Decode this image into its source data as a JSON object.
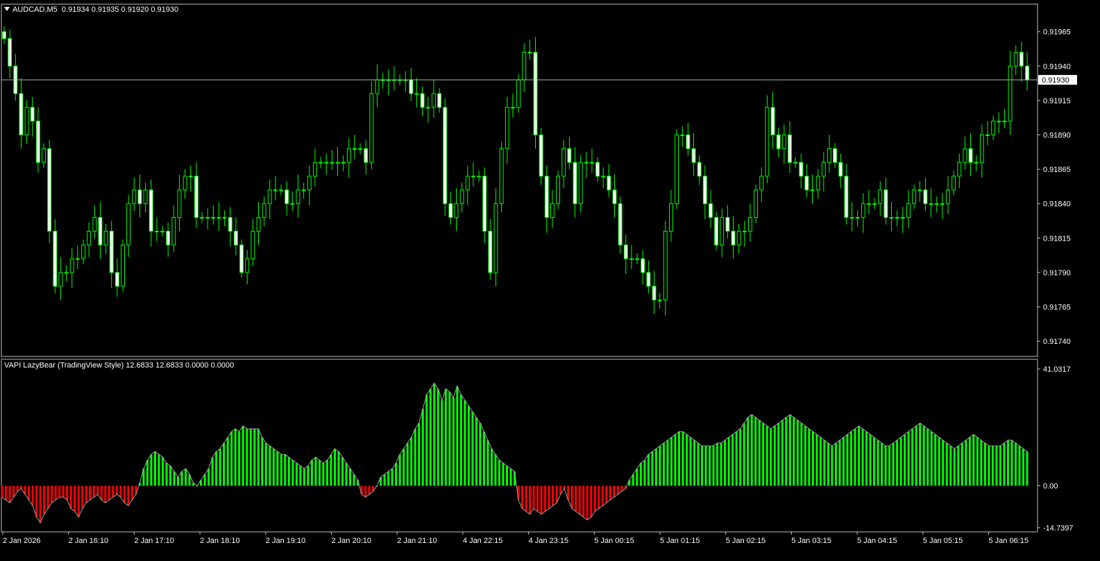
{
  "price_panel": {
    "symbol": "AUDCAD,M5",
    "ohlc": "0.91934 0.91935 0.91920 0.91930",
    "last_price": "0.91930",
    "last_price_value": 0.9193
  },
  "indicator_panel": {
    "title": "VAPI LazyBear (TradingView Style)",
    "values": "12.6833 12.6833 0.0000 0.0000"
  },
  "colors": {
    "background": "#000000",
    "grid_border": "#c0c0c0",
    "bull_candle": "#00ff00",
    "bear_candle_body": "#ffffff",
    "histogram_positive": "#00ff00",
    "histogram_negative": "#ff0000",
    "histogram_line": "#a0a0a0",
    "price_line": "#a0c0a0",
    "text": "#ffffff"
  },
  "chart_data": [
    {
      "type": "candlestick",
      "y_ticks": [
        "0.91965",
        "0.91940",
        "0.91915",
        "0.91890",
        "0.91865",
        "0.91840",
        "0.91815",
        "0.91790",
        "0.91765",
        "0.91740"
      ],
      "ylim": [
        0.91729,
        0.91985
      ],
      "x_ticks": [
        "2 Jan 2026",
        "2 Jan 16:10",
        "2 Jan 17:10",
        "2 Jan 18:10",
        "2 Jan 19:10",
        "2 Jan 20:10",
        "2 Jan 21:10",
        "4 Jan 22:15",
        "4 Jan 23:15",
        "5 Jan 00:15",
        "5 Jan 01:15",
        "5 Jan 02:15",
        "5 Jan 03:15",
        "5 Jan 04:15",
        "5 Jan 05:15",
        "5 Jan 06:15"
      ],
      "close": [
        0.9196,
        0.9194,
        0.9192,
        0.9189,
        0.9191,
        0.919,
        0.9187,
        0.9188,
        0.9182,
        0.9178,
        0.9179,
        0.9179,
        0.918,
        0.918,
        0.9181,
        0.9182,
        0.9183,
        0.9181,
        0.9182,
        0.9179,
        0.9178,
        0.9181,
        0.9184,
        0.9185,
        0.9184,
        0.9185,
        0.9182,
        0.9182,
        0.9182,
        0.9181,
        0.9183,
        0.9185,
        0.9186,
        0.9186,
        0.9183,
        0.9183,
        0.9183,
        0.9183,
        0.9183,
        0.9183,
        0.9182,
        0.9181,
        0.9179,
        0.918,
        0.9182,
        0.9183,
        0.9184,
        0.9185,
        0.9185,
        0.9185,
        0.9184,
        0.9184,
        0.9185,
        0.9185,
        0.9186,
        0.9187,
        0.9187,
        0.9187,
        0.9187,
        0.9187,
        0.9187,
        0.9188,
        0.9188,
        0.9188,
        0.9187,
        0.9192,
        0.9193,
        0.9193,
        0.9193,
        0.9193,
        0.9193,
        0.9193,
        0.9192,
        0.9192,
        0.9191,
        0.9191,
        0.9192,
        0.9191,
        0.9184,
        0.9183,
        0.9184,
        0.9185,
        0.9186,
        0.9186,
        0.9186,
        0.9182,
        0.9179,
        0.9184,
        0.9188,
        0.9191,
        0.9191,
        0.9193,
        0.9195,
        0.9195,
        0.9189,
        0.9186,
        0.9183,
        0.9184,
        0.9186,
        0.9188,
        0.9187,
        0.9184,
        0.9187,
        0.9187,
        0.9187,
        0.9186,
        0.9186,
        0.9185,
        0.9184,
        0.9181,
        0.918,
        0.918,
        0.918,
        0.9179,
        0.9178,
        0.9177,
        0.9177,
        0.9182,
        0.9184,
        0.9189,
        0.9189,
        0.9188,
        0.9187,
        0.9186,
        0.9184,
        0.9183,
        0.9181,
        0.9183,
        0.9182,
        0.9181,
        0.9182,
        0.9182,
        0.9183,
        0.9185,
        0.9186,
        0.9191,
        0.9189,
        0.9188,
        0.9189,
        0.9187,
        0.9187,
        0.9186,
        0.9185,
        0.9185,
        0.9186,
        0.9187,
        0.9188,
        0.9187,
        0.9186,
        0.9183,
        0.9183,
        0.9183,
        0.9184,
        0.9184,
        0.9184,
        0.9185,
        0.9183,
        0.9183,
        0.9183,
        0.9183,
        0.9184,
        0.9185,
        0.9185,
        0.9184,
        0.9184,
        0.9184,
        0.9184,
        0.9185,
        0.9186,
        0.9187,
        0.9188,
        0.9187,
        0.9187,
        0.9189,
        0.9189,
        0.919,
        0.919,
        0.919,
        0.9194,
        0.9195,
        0.9194,
        0.9193
      ]
    },
    {
      "type": "bar",
      "y_ticks": [
        "41.0317",
        "0.00",
        "-14.7397"
      ],
      "ylim": [
        -14.7397,
        41.0317
      ],
      "values": [
        -4,
        -5,
        -6,
        -4,
        -2,
        -1,
        -3,
        -5,
        -7,
        -11,
        -13,
        -10,
        -8,
        -6,
        -5,
        -4,
        -4,
        -5,
        -8,
        -9,
        -11,
        -8,
        -6,
        -5,
        -4,
        -3,
        -5,
        -6,
        -5,
        -4,
        -3,
        -4,
        -6,
        -7,
        -5,
        -3,
        1,
        6,
        9,
        11,
        12,
        11,
        10,
        8,
        7,
        5,
        3,
        5,
        6,
        4,
        1,
        0,
        2,
        4,
        6,
        10,
        12,
        13,
        15,
        17,
        19,
        20,
        19,
        21,
        20,
        20,
        20,
        20,
        17,
        15,
        14,
        13,
        12,
        11,
        11,
        10,
        9,
        8,
        7,
        6,
        7,
        9,
        10,
        9,
        8,
        9,
        11,
        13,
        12,
        10,
        8,
        6,
        4,
        2,
        -3,
        -4,
        -3,
        -2,
        0,
        3,
        4,
        5,
        6,
        8,
        11,
        13,
        15,
        17,
        20,
        22,
        27,
        32,
        34,
        36,
        34,
        30,
        34,
        33,
        31,
        35,
        32,
        30,
        28,
        26,
        24,
        22,
        19,
        16,
        13,
        11,
        9,
        8,
        7,
        6,
        5,
        -5,
        -8,
        -9,
        -10,
        -8,
        -9,
        -10,
        -9,
        -8,
        -7,
        -6,
        -3,
        -1,
        -5,
        -8,
        -9,
        -10,
        -11,
        -12,
        -11,
        -9,
        -8,
        -7,
        -6,
        -5,
        -4,
        -3,
        -2,
        -1,
        2,
        4,
        6,
        8,
        9,
        11,
        12,
        13,
        14,
        15,
        16,
        17,
        18,
        19,
        19,
        18,
        17,
        16,
        15,
        14,
        14,
        14,
        14,
        15,
        15,
        16,
        17,
        18,
        19,
        20,
        22,
        24,
        25,
        24,
        23,
        22,
        21,
        20,
        21,
        22,
        23,
        24,
        25,
        24,
        23,
        22,
        21,
        20,
        19,
        18,
        17,
        16,
        15,
        14,
        15,
        16,
        17,
        18,
        19,
        20,
        21,
        20,
        19,
        18,
        17,
        16,
        15,
        14,
        14,
        15,
        16,
        17,
        18,
        19,
        20,
        21,
        22,
        21,
        20,
        19,
        18,
        17,
        16,
        15,
        14,
        13,
        14,
        15,
        16,
        17,
        18,
        17,
        16,
        15,
        14,
        14,
        14,
        14,
        15,
        16,
        16,
        15,
        14,
        13,
        12
      ]
    }
  ]
}
